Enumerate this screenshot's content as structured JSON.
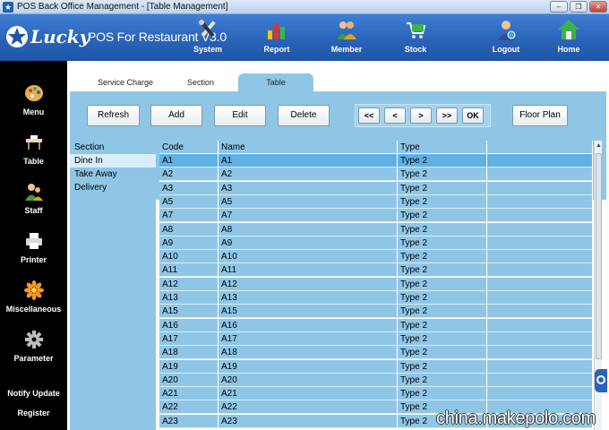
{
  "window": {
    "title": "POS Back Office Management - [Table Management]",
    "controls": {
      "minimize": "–",
      "restore": "❐",
      "close": "✕"
    }
  },
  "brand": {
    "lucky": "Lucky",
    "product": "POS For Restaurant V3.0"
  },
  "top_nav": [
    {
      "label": "System",
      "icon": "tools-icon"
    },
    {
      "label": "Report",
      "icon": "bar-chart-icon"
    },
    {
      "label": "Member",
      "icon": "members-icon"
    },
    {
      "label": "Stock",
      "icon": "cart-icon"
    },
    {
      "label": "Logout",
      "icon": "user-logout-icon"
    },
    {
      "label": "Home",
      "icon": "home-icon"
    }
  ],
  "sidebar": {
    "items": [
      {
        "label": "Menu",
        "icon": "palette-icon"
      },
      {
        "label": "Table",
        "icon": "table-icon"
      },
      {
        "label": "Staff",
        "icon": "staff-icon"
      },
      {
        "label": "Printer",
        "icon": "printer-icon"
      },
      {
        "label": "Miscellaneous",
        "icon": "flower-icon"
      },
      {
        "label": "Parameter",
        "icon": "gear-icon"
      }
    ],
    "notify_update": "Notify Update",
    "register": "Register"
  },
  "tabs": [
    {
      "label": "Service Charge",
      "active": false
    },
    {
      "label": "Section",
      "active": false
    },
    {
      "label": "Table",
      "active": true
    }
  ],
  "toolbar": {
    "refresh": "Refresh",
    "add": "Add",
    "edit": "Edit",
    "delete": "Delete",
    "first": "<<",
    "prev": "<",
    "next": ">",
    "last": ">>",
    "ok": "OK",
    "floor_plan": "Floor Plan"
  },
  "section_list": {
    "header": "Section",
    "items": [
      "Dine In",
      "Take Away",
      "Delivery"
    ],
    "selected": "Dine In"
  },
  "table_grid": {
    "columns": [
      "Code",
      "Name",
      "Type"
    ],
    "rows": [
      [
        "A1",
        "A1",
        "Type 2"
      ],
      [
        "A2",
        "A2",
        "Type 2"
      ],
      [
        "A3",
        "A3",
        "Type 2"
      ],
      [
        "A5",
        "A5",
        "Type 2"
      ],
      [
        "A7",
        "A7",
        "Type 2"
      ],
      [
        "A8",
        "A8",
        "Type 2"
      ],
      [
        "A9",
        "A9",
        "Type 2"
      ],
      [
        "A10",
        "A10",
        "Type 2"
      ],
      [
        "A11",
        "A11",
        "Type 2"
      ],
      [
        "A12",
        "A12",
        "Type 2"
      ],
      [
        "A13",
        "A13",
        "Type 2"
      ],
      [
        "A15",
        "A15",
        "Type 2"
      ],
      [
        "A16",
        "A16",
        "Type 2"
      ],
      [
        "A17",
        "A17",
        "Type 2"
      ],
      [
        "A18",
        "A18",
        "Type 2"
      ],
      [
        "A19",
        "A19",
        "Type 2"
      ],
      [
        "A20",
        "A20",
        "Type 2"
      ],
      [
        "A21",
        "A21",
        "Type 2"
      ],
      [
        "A22",
        "A22",
        "Type 2"
      ],
      [
        "A23",
        "A23",
        "Type 2"
      ]
    ]
  },
  "watermark": "china.makepolo.com",
  "colors": {
    "header_blue": "#2a63b8",
    "panel_blue": "#8fc6e6",
    "selected_blue": "#5fb0e3",
    "sidebar_black": "#000000"
  }
}
